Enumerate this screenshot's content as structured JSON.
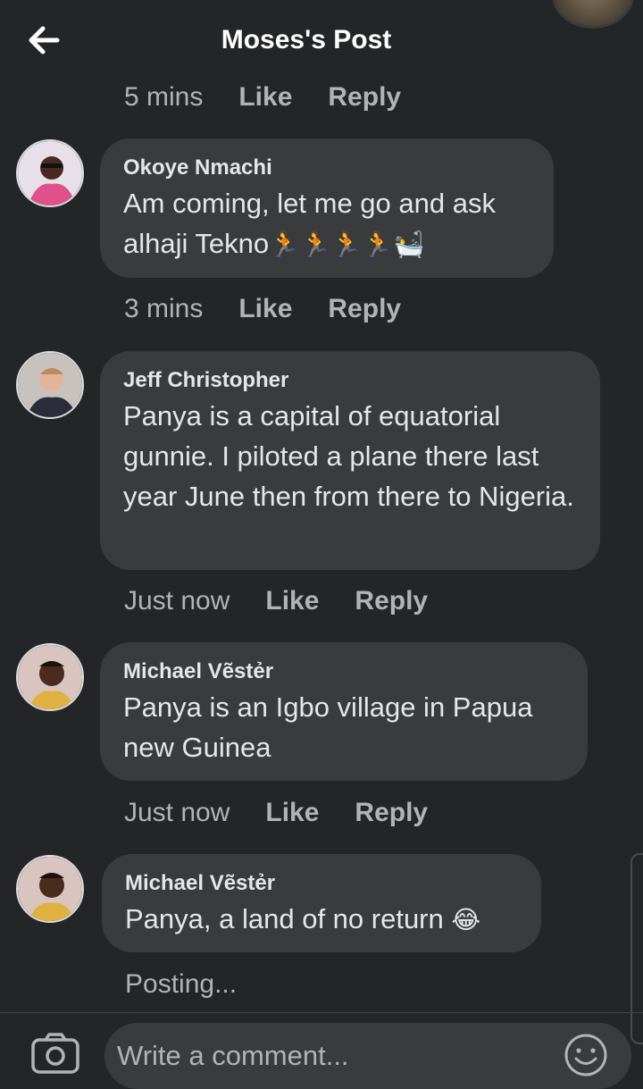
{
  "header": {
    "title": "Moses's Post",
    "back_icon": "arrow-left-icon"
  },
  "top_meta": {
    "time": "5 mins",
    "like": "Like",
    "reply": "Reply"
  },
  "comments": [
    {
      "author": "Okoye Nmachi",
      "text": "Am coming, let me go and ask alhaji Tekno",
      "emoji": "🏃🏃🏃🏃🛀",
      "time": "3 mins",
      "like": "Like",
      "reply": "Reply"
    },
    {
      "author": "Jeff Christopher",
      "text": "Panya is a capital of equatorial gunnie. I piloted a plane there last year June then from there to Nigeria.",
      "time": "Just now",
      "like": "Like",
      "reply": "Reply"
    },
    {
      "author": "Michael Vẽstẻr",
      "text": "Panya is an Igbo village in Papua new Guinea",
      "time": "Just now",
      "like": "Like",
      "reply": "Reply"
    },
    {
      "author": "Michael Vẽstẻr",
      "text": "Panya, a land of no return",
      "emoji": "😂",
      "status": "Posting..."
    }
  ],
  "composer": {
    "placeholder": "Write a comment...",
    "camera_icon": "camera-icon",
    "emoji_icon": "smiley-icon"
  },
  "colors": {
    "background": "#242526",
    "bubble": "#3a3b3c",
    "text": "#e4e6eb",
    "muted": "#b0b3b8"
  }
}
